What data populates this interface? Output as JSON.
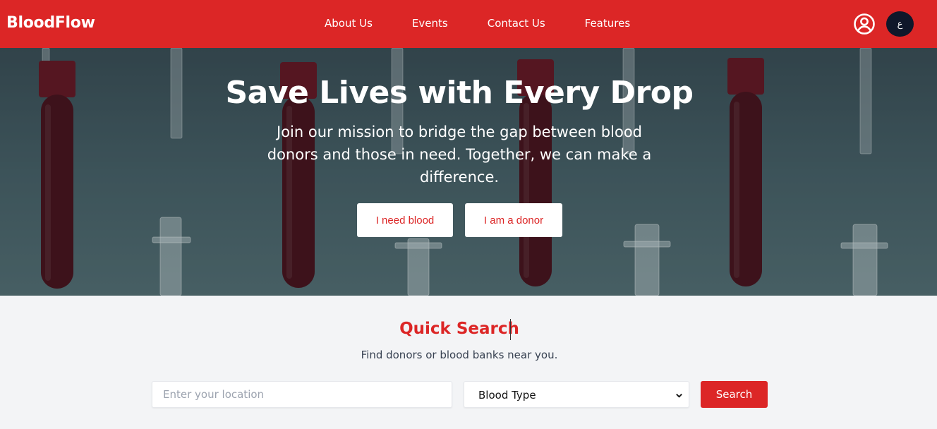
{
  "navbar": {
    "brand": "BloodFlow",
    "links": [
      "About Us",
      "Events",
      "Contact Us",
      "Features"
    ],
    "lang_label": "ع",
    "colors": {
      "bg": "#dc2626",
      "lang_bg": "#0f172a"
    }
  },
  "hero": {
    "title": "Save Lives with Every Drop",
    "subtitle": "Join our mission to bridge the gap between blood donors and those in need. Together, we can make a difference.",
    "need_blood_label": "I need blood",
    "donor_label": "I am a donor"
  },
  "quick_search": {
    "title": "Quick Search",
    "subtitle": "Find donors or blood banks near you.",
    "location_placeholder": "Enter your location",
    "location_value": "",
    "blood_type_selected": "Blood Type",
    "search_label": "Search"
  },
  "icons": {
    "profile": "user-circle-icon",
    "select": "chevron-down-icon"
  },
  "colors": {
    "accent": "#dc2626",
    "page_bg": "#f3f4f6"
  }
}
